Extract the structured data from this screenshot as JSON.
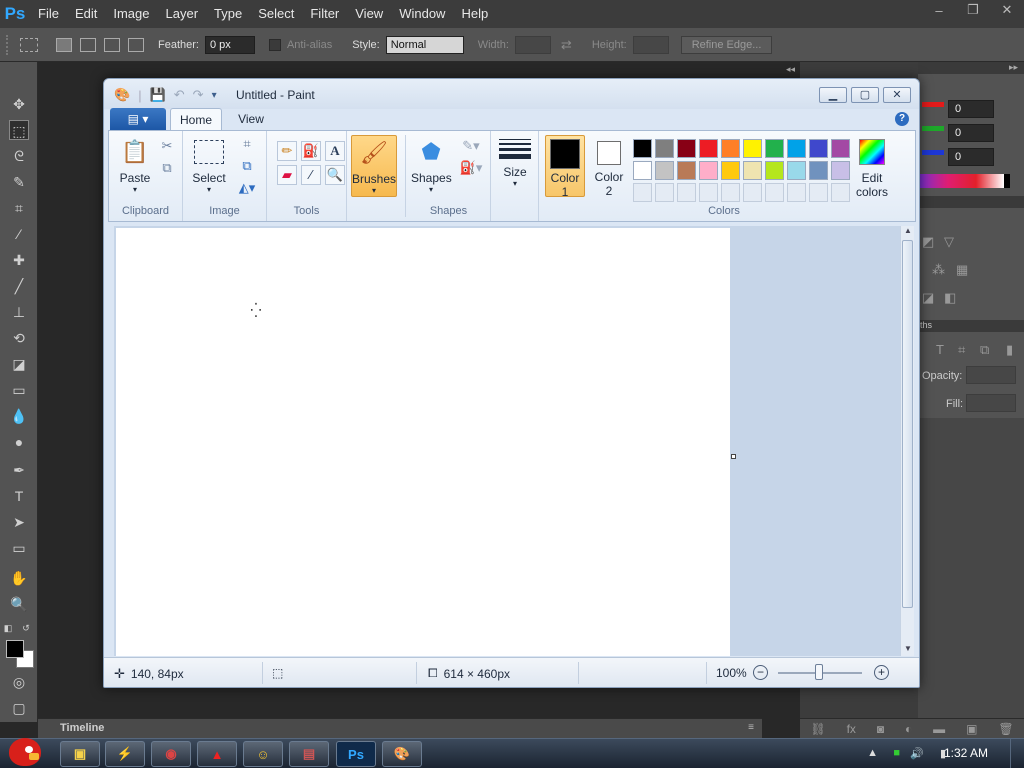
{
  "photoshop": {
    "logo": "Ps",
    "menu": [
      "File",
      "Edit",
      "Image",
      "Layer",
      "Type",
      "Select",
      "Filter",
      "View",
      "Window",
      "Help"
    ],
    "window_controls": [
      "–",
      "❐",
      "✕"
    ],
    "options": {
      "feather_label": "Feather:",
      "feather_value": "0 px",
      "antialias_label": "Anti-alias",
      "style_label": "Style:",
      "style_value": "Normal",
      "width_label": "Width:",
      "height_label": "Height:",
      "refine_edge_label": "Refine Edge..."
    },
    "color_panel": {
      "r": "0",
      "g": "0",
      "b": "0",
      "red_color": "#e41b1b",
      "green_color": "#1ea82a",
      "blue_color": "#1d37d6"
    },
    "layers_panel": {
      "tab_label": "ths",
      "opacity_label": "Opacity:",
      "fill_label": "Fill:"
    },
    "timeline_label": "Timeline",
    "foreground_color": "#000000",
    "background_color": "#ffffff"
  },
  "paint": {
    "title": "Untitled - Paint",
    "tabs": {
      "home": "Home",
      "view": "View"
    },
    "help": "?",
    "ribbon": {
      "clipboard": {
        "label": "Clipboard",
        "paste": "Paste"
      },
      "image": {
        "label": "Image",
        "select": "Select"
      },
      "tools": {
        "label": "Tools"
      },
      "brushes": "Brushes",
      "shapes": {
        "label": "Shapes",
        "button": "Shapes"
      },
      "size": "Size",
      "colors": {
        "label": "Colors",
        "color1_line1": "Color",
        "color1_line2": "1",
        "color2_line1": "Color",
        "color2_line2": "2",
        "edit_line1": "Edit",
        "edit_line2": "colors",
        "color1_value": "#000000",
        "color2_value": "#ffffff",
        "palette_row1": [
          "#000000",
          "#7f7f7f",
          "#880015",
          "#ed1c24",
          "#ff7f27",
          "#fff200",
          "#22b14c",
          "#00a2e8",
          "#3f48cc",
          "#a349a4"
        ],
        "palette_row2": [
          "#ffffff",
          "#c3c3c3",
          "#b97a57",
          "#ffaec9",
          "#ffc90e",
          "#efe4b0",
          "#b5e61d",
          "#99d9ea",
          "#7092be",
          "#c8bfe7"
        ]
      }
    },
    "status": {
      "cursor_pos": "140, 84px",
      "image_size": "614 × 460px",
      "zoom": "100%"
    }
  },
  "taskbar": {
    "clock": "1:32 AM"
  }
}
